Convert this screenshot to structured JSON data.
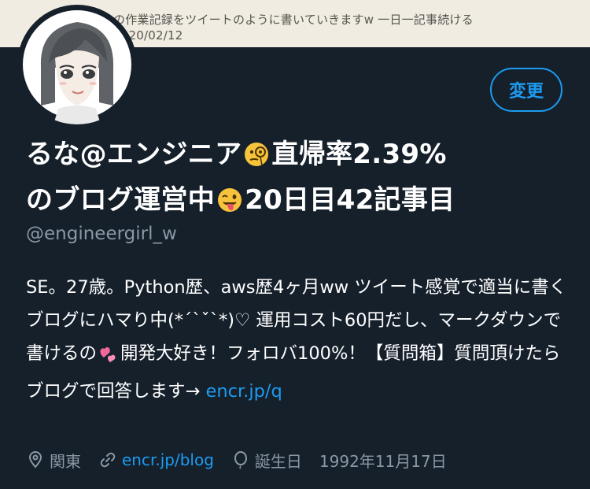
{
  "banner": {
    "line1": "の作業記録をツイートのように書いていきますw 一日一記事続ける",
    "line2": "2020/02/12"
  },
  "profile": {
    "edit_label": "変更",
    "name_part1": "るな@エンジニア",
    "name_part2": "直帰率2.39%",
    "name_part3": "のブログ運営中",
    "name_part4": "20日目42記事目",
    "handle": "@engineergirl_w"
  },
  "bio": {
    "text1": "SE。27歳。Python歴、aws歴4ヶ月ww ツイート感覚で適当に書くブログにハマり中(*´`ˇ`*)♡ 運用コスト60円だし、マークダウンで書けるの",
    "text2": "開発大好き！フォロバ100%！【質問箱】質問頂けたらブログで回答します→ ",
    "link": "encr.jp/q"
  },
  "meta": {
    "location": "関東",
    "website": "encr.jp/blog",
    "birthday_label": "誕生日",
    "birthday": "1992年11月17日"
  },
  "icons": {
    "monocle": "face-with-monocle-icon",
    "tongue": "winking-face-with-tongue-icon",
    "hearts": "two-hearts-icon",
    "location": "location-pin-icon",
    "link": "link-icon",
    "balloon": "balloon-icon"
  }
}
